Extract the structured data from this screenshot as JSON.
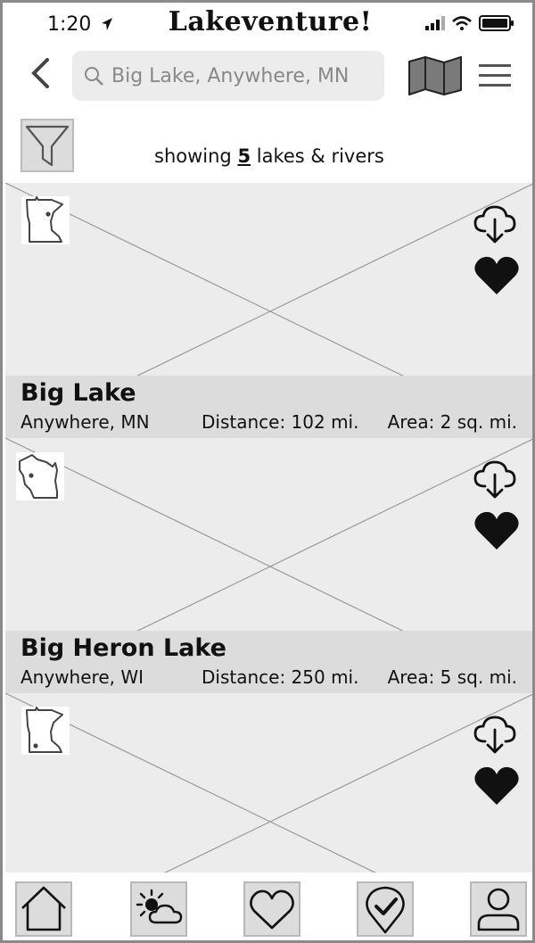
{
  "status_bar": {
    "time": "1:20",
    "app_title": "Lakeventure!"
  },
  "search": {
    "placeholder": "Big Lake, Anywhere, MN"
  },
  "results": {
    "prefix": "showing",
    "count": "5",
    "suffix": "lakes & rivers"
  },
  "lakes": [
    {
      "name": "Big Lake",
      "location": "Anywhere, MN",
      "distance": "Distance: 102 mi.",
      "area": "Area: 2 sq. mi.",
      "state_icon": "minnesota-icon"
    },
    {
      "name": "Big Heron Lake",
      "location": "Anywhere, WI",
      "distance": "Distance: 250 mi.",
      "area": "Area: 5 sq. mi.",
      "state_icon": "wisconsin-icon"
    },
    {
      "name": "",
      "location": "",
      "distance": "",
      "area": "",
      "state_icon": "minnesota-icon"
    }
  ],
  "tabs": [
    {
      "icon": "home-icon"
    },
    {
      "icon": "weather-icon"
    },
    {
      "icon": "heart-icon"
    },
    {
      "icon": "checked-location-icon"
    },
    {
      "icon": "profile-icon"
    }
  ]
}
